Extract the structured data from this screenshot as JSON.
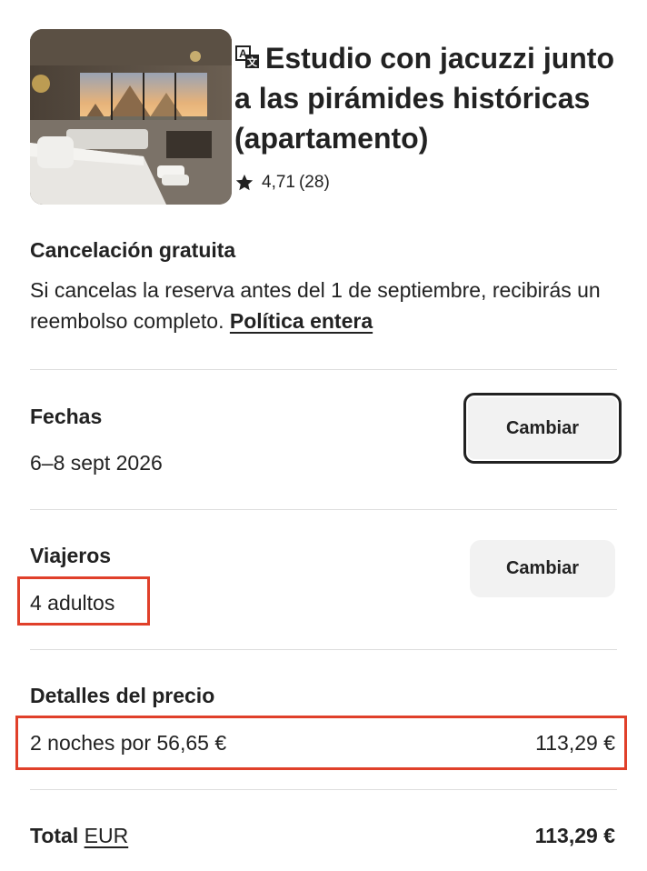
{
  "listing": {
    "title": "Estudio con jacuzzi junto a las pirámides históricas (apartamento)",
    "rating": "4,71",
    "reviews": "(28)",
    "image_icon": "room-photo",
    "translate_icon": "translate-icon",
    "star_icon": "star-icon"
  },
  "cancellation": {
    "heading": "Cancelación gratuita",
    "text": "Si cancelas la reserva antes del 1 de septiembre, recibirás un reembolso completo.",
    "link_label": "Política entera"
  },
  "dates": {
    "heading": "Fechas",
    "value": "6–8 sept 2026",
    "change_label": "Cambiar"
  },
  "travelers": {
    "heading": "Viajeros",
    "value": "4 adultos",
    "change_label": "Cambiar"
  },
  "price": {
    "heading": "Detalles del precio",
    "line_label": "2 noches por 56,65 €",
    "line_amount": "113,29 €",
    "total_label": "Total",
    "currency": "EUR",
    "total_amount": "113,29 €"
  },
  "colors": {
    "highlight": "#e0402a",
    "text": "#222222",
    "button_bg": "#f2f2f2",
    "divider": "#dddddd"
  }
}
